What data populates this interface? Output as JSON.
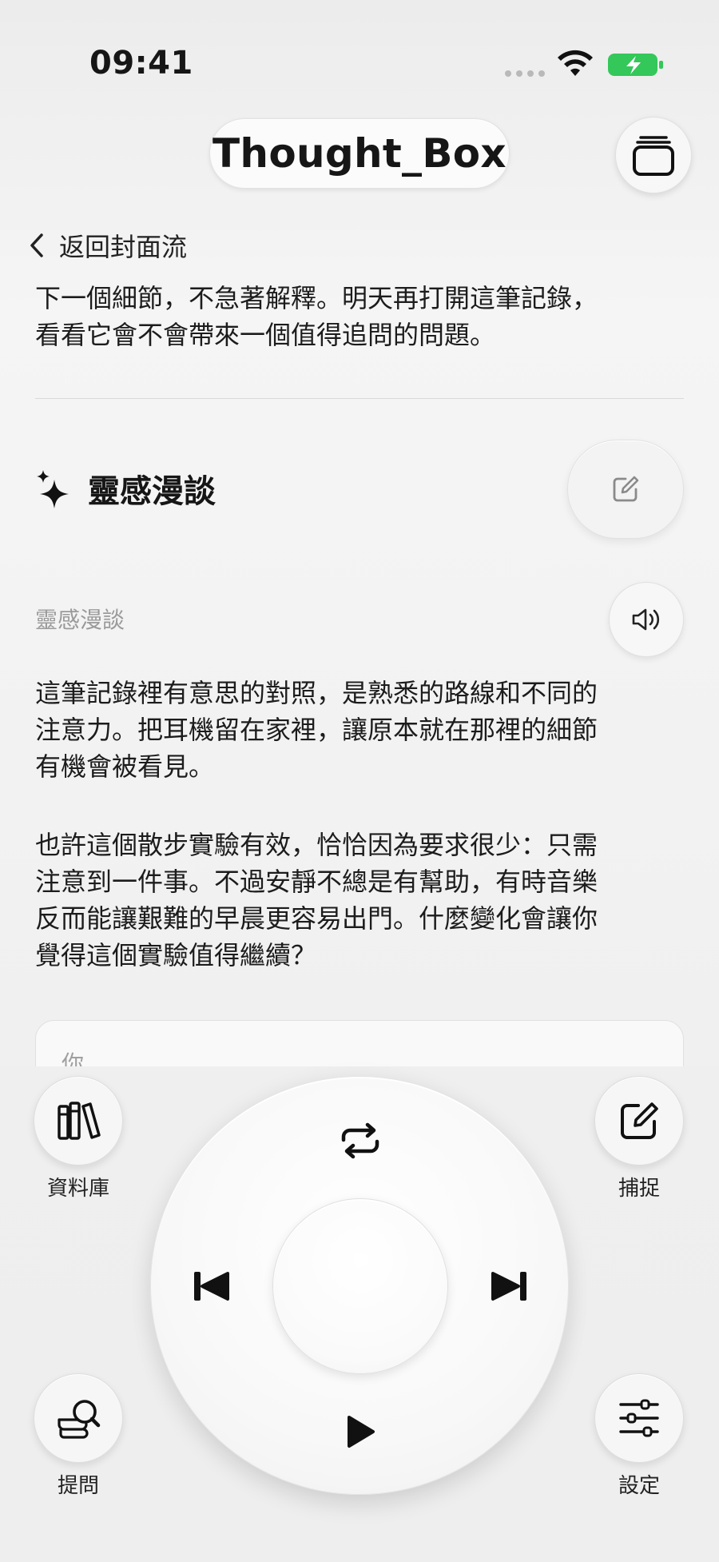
{
  "status_bar": {
    "time": "09:41"
  },
  "header": {
    "app_title": "Thought_Box"
  },
  "nav": {
    "back_label": "返回封面流"
  },
  "content": {
    "intro_lines": [
      "下一個細節，不急著解釋。明天再打開這筆記錄，",
      "看看它會不會帶來一個值得追問的問題。"
    ],
    "section_title": "靈感漫談",
    "sub_label": "靈感漫談",
    "paragraph_1_lines": [
      "這筆記錄裡有意思的對照，是熟悉的路線和不同的",
      "注意力。把耳機留在家裡，讓原本就在那裡的細節",
      "有機會被看見。"
    ],
    "paragraph_2_lines": [
      "也許這個散步實驗有效，恰恰因為要求很少：只需",
      "注意到一件事。不過安靜不總是有幫助，有時音樂",
      "反而能讓艱難的早晨更容易出門。什麼變化會讓你",
      "覺得這個實驗值得繼續？"
    ],
    "you_card_label": "你"
  },
  "dock": {
    "library_label": "資料庫",
    "capture_label": "捕捉",
    "ask_label": "提問",
    "settings_label": "設定"
  },
  "icons": {
    "section": "sparkles-icon",
    "edit": "edit-icon",
    "speaker": "speaker-icon",
    "stack": "stack-icon",
    "library": "books-icon",
    "capture": "compose-icon",
    "ask": "search-scroll-icon",
    "settings": "sliders-icon",
    "repeat": "repeat-icon",
    "previous": "skip-back-icon",
    "next": "skip-forward-icon",
    "play": "play-icon"
  },
  "colors": {
    "battery": "#34c759",
    "background": "#f2f2f2",
    "text": "#161616",
    "muted": "#9a9a9a"
  }
}
